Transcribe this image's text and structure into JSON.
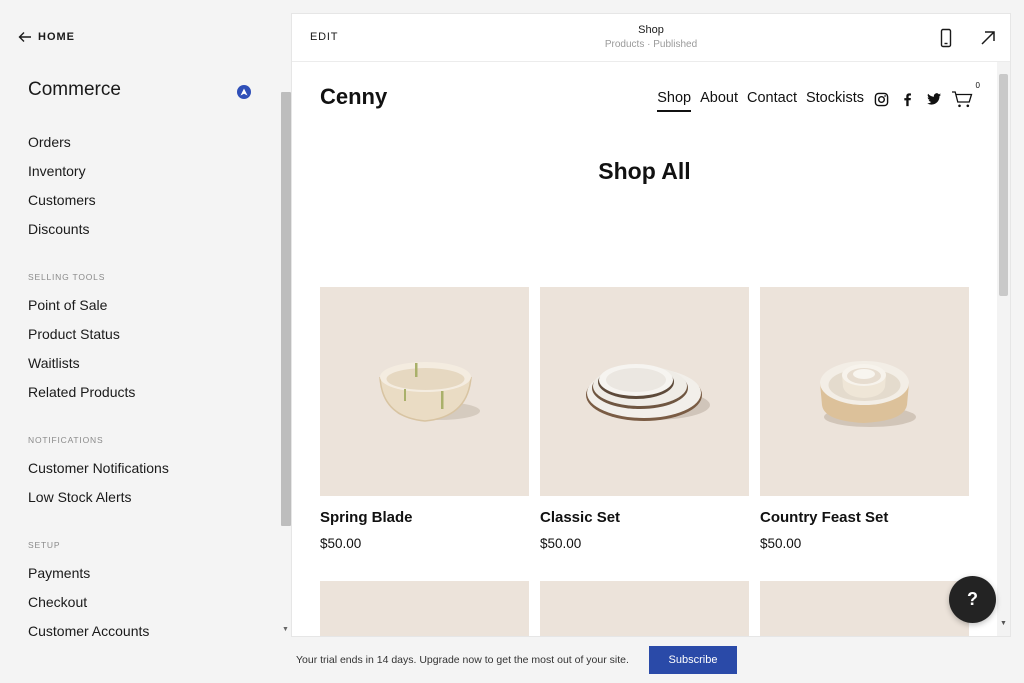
{
  "sidebar": {
    "home_label": "HOME",
    "title": "Commerce",
    "main_items": [
      {
        "label": "Orders"
      },
      {
        "label": "Inventory"
      },
      {
        "label": "Customers"
      },
      {
        "label": "Discounts"
      }
    ],
    "sections": [
      {
        "heading": "SELLING TOOLS",
        "items": [
          {
            "label": "Point of Sale"
          },
          {
            "label": "Product Status"
          },
          {
            "label": "Waitlists"
          },
          {
            "label": "Related Products"
          }
        ]
      },
      {
        "heading": "NOTIFICATIONS",
        "items": [
          {
            "label": "Customer Notifications"
          },
          {
            "label": "Low Stock Alerts"
          }
        ]
      },
      {
        "heading": "SETUP",
        "items": [
          {
            "label": "Payments"
          },
          {
            "label": "Checkout"
          },
          {
            "label": "Customer Accounts"
          }
        ]
      }
    ]
  },
  "topbar": {
    "edit_label": "EDIT",
    "page_title": "Shop",
    "page_status": "Products · Published",
    "icons": [
      "mobile-preview-icon",
      "open-external-icon"
    ]
  },
  "site": {
    "logo": "Cenny",
    "nav": [
      {
        "label": "Shop",
        "active": true
      },
      {
        "label": "About",
        "active": false
      },
      {
        "label": "Contact",
        "active": false
      },
      {
        "label": "Stockists",
        "active": false
      }
    ],
    "social_icons": [
      "instagram-icon",
      "facebook-icon",
      "twitter-icon"
    ],
    "cart_count": "0",
    "heading": "Shop All",
    "products": [
      {
        "name": "Spring Blade",
        "price": "$50.00",
        "image": "bowl"
      },
      {
        "name": "Classic Set",
        "price": "$50.00",
        "image": "plates"
      },
      {
        "name": "Country Feast Set",
        "price": "$50.00",
        "image": "nested-bowls"
      }
    ]
  },
  "help_label": "?",
  "footer": {
    "trial_text": "Your trial ends in 14 days. Upgrade now to get the most out of your site.",
    "subscribe_label": "Subscribe"
  },
  "colors": {
    "accent": "#2a4aa8",
    "product_bg": "#ece3da",
    "sidebar_bg": "#f4f4f4"
  }
}
